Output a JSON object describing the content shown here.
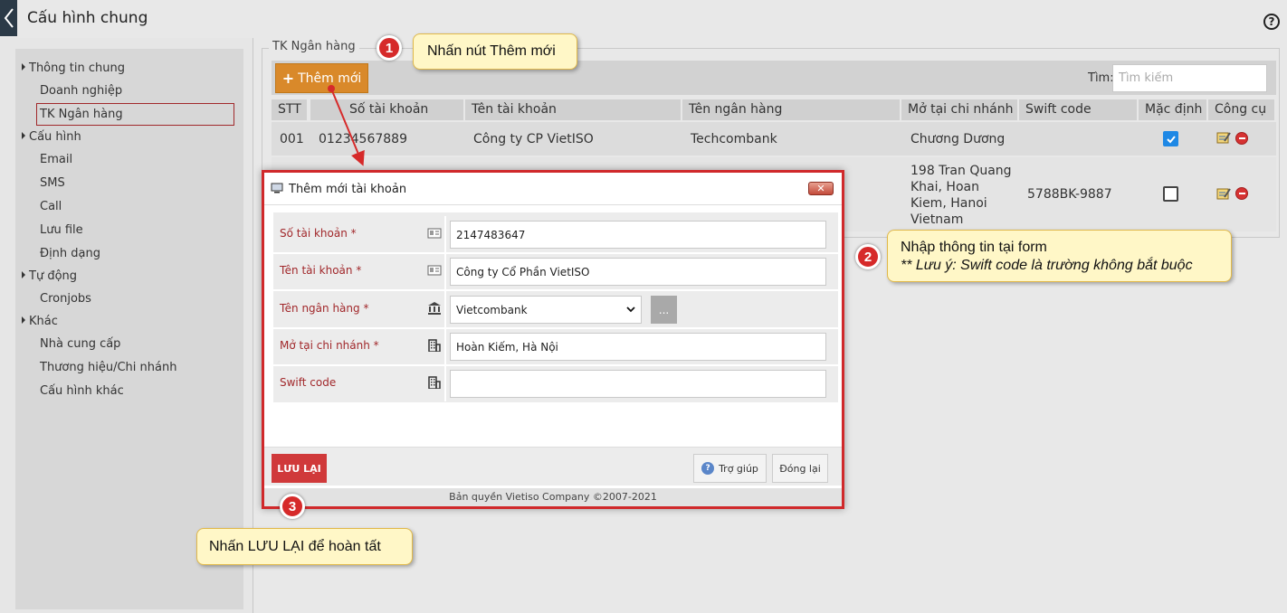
{
  "header": {
    "title": "Cấu hình chung",
    "help_glyph": "?"
  },
  "sidebar": {
    "items": [
      {
        "label": "Thông tin chung",
        "group": true
      },
      {
        "label": "Doanh nghiệp",
        "group": false
      },
      {
        "label": "TK Ngân hàng",
        "group": false,
        "active": true
      },
      {
        "label": "Cấu hình",
        "group": true
      },
      {
        "label": "Email",
        "group": false
      },
      {
        "label": "SMS",
        "group": false
      },
      {
        "label": "Call",
        "group": false
      },
      {
        "label": "Lưu file",
        "group": false
      },
      {
        "label": "Định dạng",
        "group": false
      },
      {
        "label": "Tự động",
        "group": true
      },
      {
        "label": "Cronjobs",
        "group": false
      },
      {
        "label": "Khác",
        "group": true
      },
      {
        "label": "Nhà cung cấp",
        "group": false
      },
      {
        "label": "Thương hiệu/Chi nhánh",
        "group": false
      },
      {
        "label": "Cấu hình khác",
        "group": false
      }
    ]
  },
  "section": {
    "legend": "TK Ngân hàng",
    "add_button": "Thêm mới",
    "search_label": "Tìm:",
    "search_placeholder": "Tìm kiếm"
  },
  "table": {
    "columns": [
      "STT",
      "Số tài khoản",
      "Tên tài khoản",
      "Tên ngân hàng",
      "Mở tại chi nhánh",
      "Swift code",
      "Mặc định",
      "Công cụ"
    ],
    "rows": [
      {
        "stt": "001",
        "account_no": "01234567889",
        "account_name": "Công ty CP VietISO",
        "bank": "Techcombank",
        "branch": [
          "Chương Dương"
        ],
        "swift": "",
        "default": true
      },
      {
        "stt": "",
        "account_no": "",
        "account_name": "",
        "bank": "",
        "branch": [
          "198 Tran Quang",
          "Khai, Hoan",
          "Kiem, Hanoi",
          "Vietnam"
        ],
        "swift": "5788BK-9887",
        "default": false
      }
    ]
  },
  "modal": {
    "title": "Thêm mới tài khoản",
    "close_glyph": "✕",
    "fields": {
      "account_no": {
        "label": "Số tài khoản *",
        "value": "2147483647"
      },
      "account_name": {
        "label": "Tên tài khoản *",
        "value": "Công ty Cổ Phần VietISO"
      },
      "bank": {
        "label": "Tên ngân hàng *",
        "value": "Vietcombank",
        "more": "..."
      },
      "branch": {
        "label": "Mở tại chi nhánh *",
        "value": "Hoàn Kiếm, Hà Nội"
      },
      "swift": {
        "label": "Swift code",
        "value": ""
      }
    },
    "save_button": "LƯU LẠI",
    "help_button": "Trợ giúp",
    "close_button": "Đóng lại",
    "copyright": "Bản quyền Vietiso Company ©2007-2021"
  },
  "callouts": {
    "step1": {
      "number": "1",
      "text": "Nhấn nút Thêm mới"
    },
    "step2": {
      "number": "2",
      "line1": "Nhập thông tin tại form",
      "line2": "** Lưu ý: Swift code là trường không bắt buộc"
    },
    "step3": {
      "number": "3",
      "text": "Nhấn LƯU LẠI để hoàn tất"
    }
  },
  "colors": {
    "accent_orange": "#d9892a",
    "save_red": "#d0393a",
    "label_red": "#a1282b",
    "callout_bg": "#fff7c7",
    "checkbox_blue": "#1e88e5"
  }
}
